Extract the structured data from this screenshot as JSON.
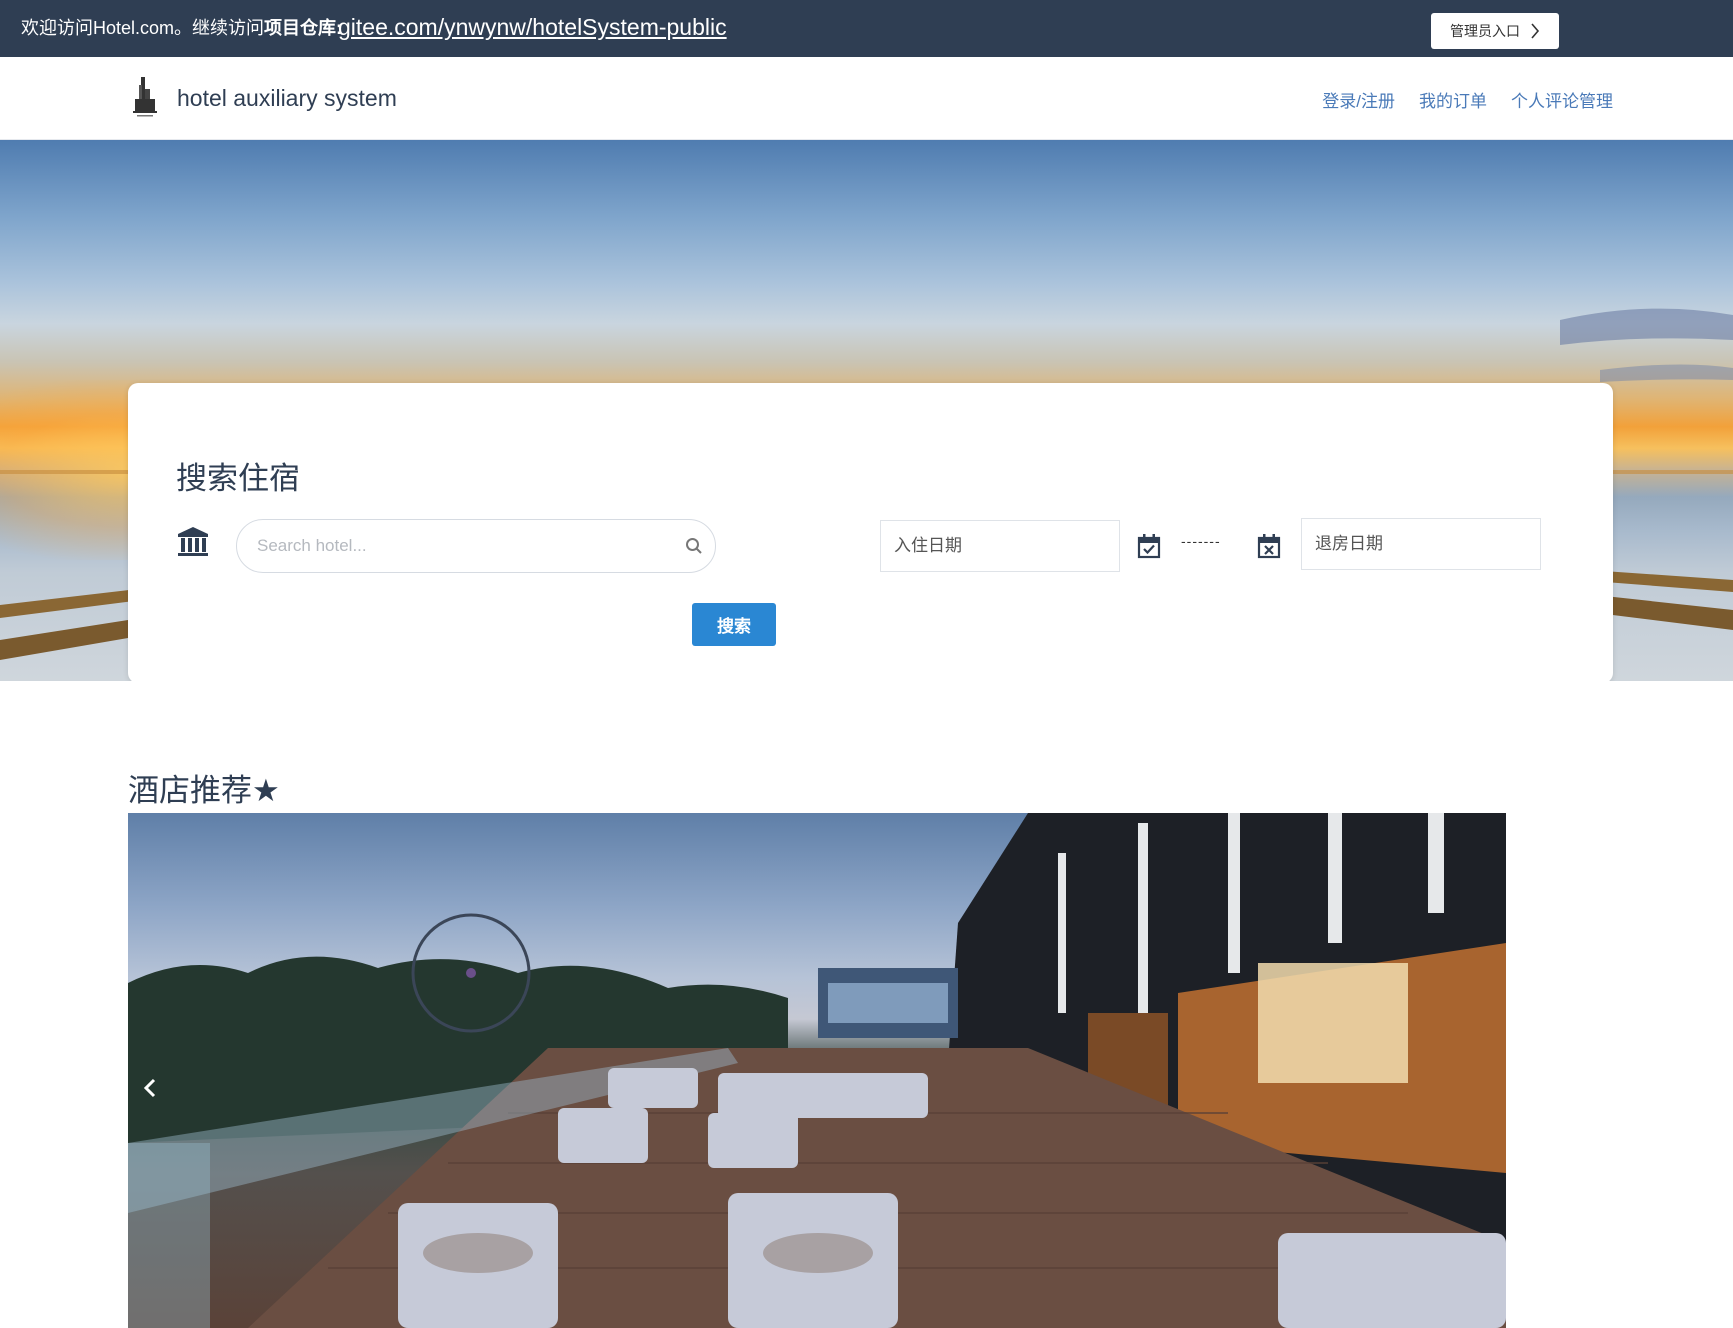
{
  "topbar": {
    "welcome_text": "欢迎访问Hotel.com。继续访问",
    "repo_label": "项目仓库:",
    "repo_link": "gitee.com/ynwynw/hotelSystem-public",
    "admin_button": "管理员入口"
  },
  "header": {
    "brand": "hotel auxiliary system",
    "nav": [
      {
        "label": "登录/注册"
      },
      {
        "label": "我的订单"
      },
      {
        "label": "个人评论管理"
      }
    ]
  },
  "search": {
    "title": "搜索住宿",
    "placeholder": "Search hotel...",
    "checkin_placeholder": "入住日期",
    "checkout_placeholder": "退房日期",
    "separator": "-------",
    "button": "搜索"
  },
  "recommend": {
    "title": "酒店推荐★"
  },
  "colors": {
    "topbar_bg": "#2f3e53",
    "nav_link": "#4a7ab8",
    "primary_button": "#2a87d3",
    "heading": "#2f3e53"
  }
}
